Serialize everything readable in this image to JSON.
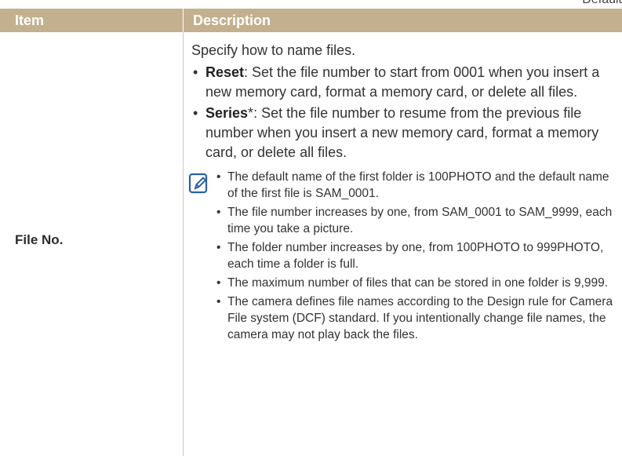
{
  "corner_label": "Default",
  "table": {
    "header": {
      "item": "Item",
      "description": "Description"
    },
    "row": {
      "item": "File No.",
      "intro": "Specify how to name files.",
      "options": [
        {
          "name": "Reset",
          "suffix": "",
          "text": ": Set the file number to start from 0001 when you insert a new memory card, format a memory card, or delete all files."
        },
        {
          "name": "Series",
          "suffix": "*",
          "text": ": Set the file number to resume from the previous file number when you insert a new memory card, format a memory card, or delete all files."
        }
      ],
      "note_icon": "note-pencil-icon",
      "notes": [
        "The default name of the first folder is 100PHOTO and the default name of the first file is SAM_0001.",
        "The file number increases by one, from SAM_0001 to SAM_9999, each time you take a picture.",
        "The folder number increases by one, from 100PHOTO to 999PHOTO, each time a folder is full.",
        "The maximum number of files that can be stored in one folder is 9,999.",
        "The camera defines file names according to the Design rule for Camera File system (DCF) standard. If you intentionally change file names, the camera may not play back the files."
      ]
    }
  }
}
